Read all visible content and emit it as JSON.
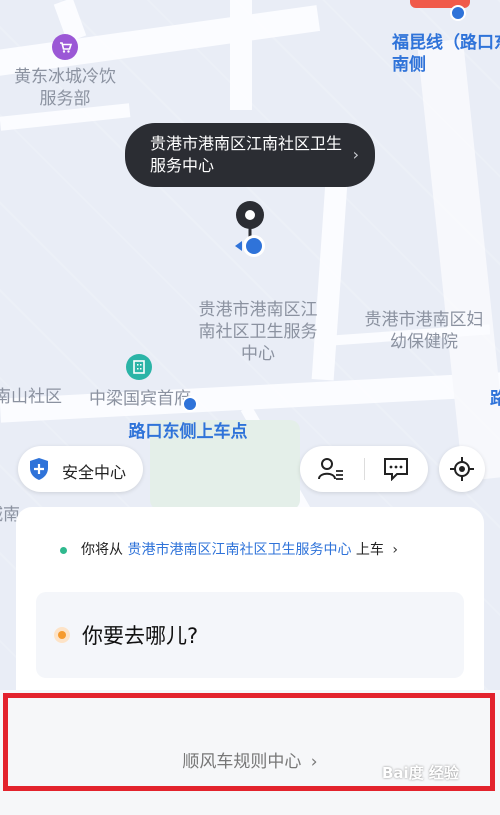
{
  "map": {
    "poi_ice_shop": "黄东冰城冷饮服务部",
    "road_label_top_right": "福昆线（路口东南侧",
    "pickup_bubble": "贵港市港南区江南社区卫生服务中心",
    "center_label": "贵港市港南区江南社区卫生服务中心",
    "hospital_label": "贵港市港南区妇幼保健院",
    "hotel_label": "中梁国宾首府",
    "community_label": "南山社区",
    "pickup_point_label": "路口东侧上车点",
    "left_edge_fragment": "城南",
    "right_edge_fragment": "路"
  },
  "controls": {
    "safety_center": "安全中心"
  },
  "card": {
    "from_prefix": "你将从",
    "from_place": "贵港市港南区江南社区卫生服务中心",
    "from_suffix": "上车",
    "destination_placeholder": "你要去哪儿?"
  },
  "footer": {
    "rules_link": "顺风车规则中心"
  },
  "watermark": "Bai度 经验"
}
